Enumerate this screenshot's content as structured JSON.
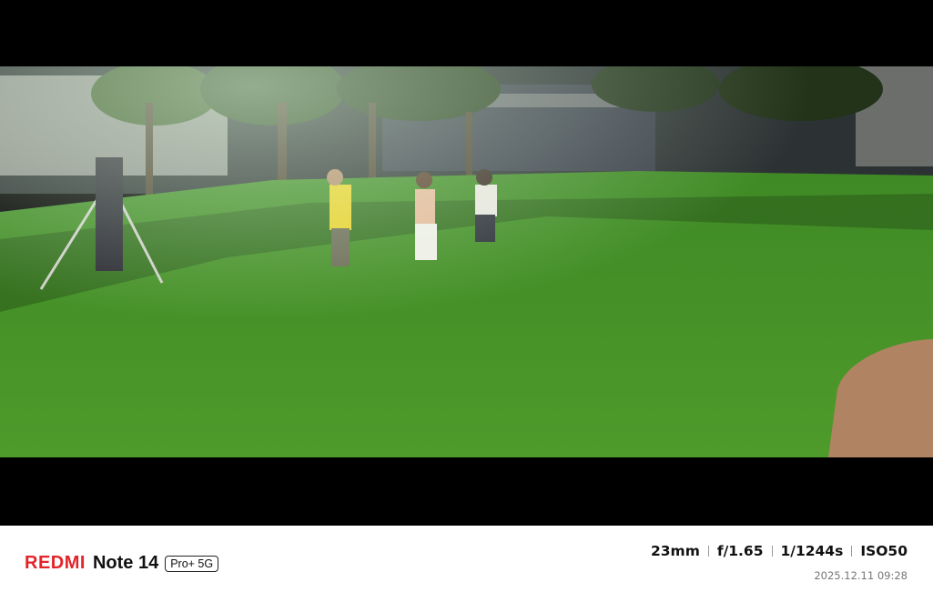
{
  "footer": {
    "brand": "REDMI",
    "model": "Note 14",
    "badge": "Pro+ 5G",
    "focal_length": "23mm",
    "aperture": "f/1.65",
    "shutter": "1/1244s",
    "iso": "ISO50",
    "timestamp": "2025.12.11 09:28"
  },
  "colors": {
    "brand_red": "#e1252b",
    "letterbox": "#000000",
    "footer_bg": "#ffffff"
  }
}
